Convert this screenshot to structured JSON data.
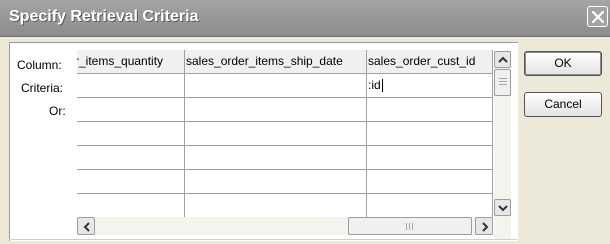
{
  "dialog": {
    "title": "Specify Retrieval Criteria"
  },
  "row_labels": {
    "column": "Column:",
    "criteria": "Criteria:",
    "or": "Or:"
  },
  "columns": [
    "r_items_quantity",
    "sales_order_items_ship_date",
    "sales_order_cust_id"
  ],
  "criteria_values": [
    "",
    "",
    ":id"
  ],
  "buttons": {
    "ok": "OK",
    "cancel": "Cancel"
  },
  "icons": {
    "close": "close-icon",
    "scroll_up": "scroll-up-arrow-icon",
    "scroll_down": "scroll-down-arrow-icon",
    "scroll_left": "scroll-left-arrow-icon",
    "scroll_right": "scroll-right-arrow-icon"
  }
}
